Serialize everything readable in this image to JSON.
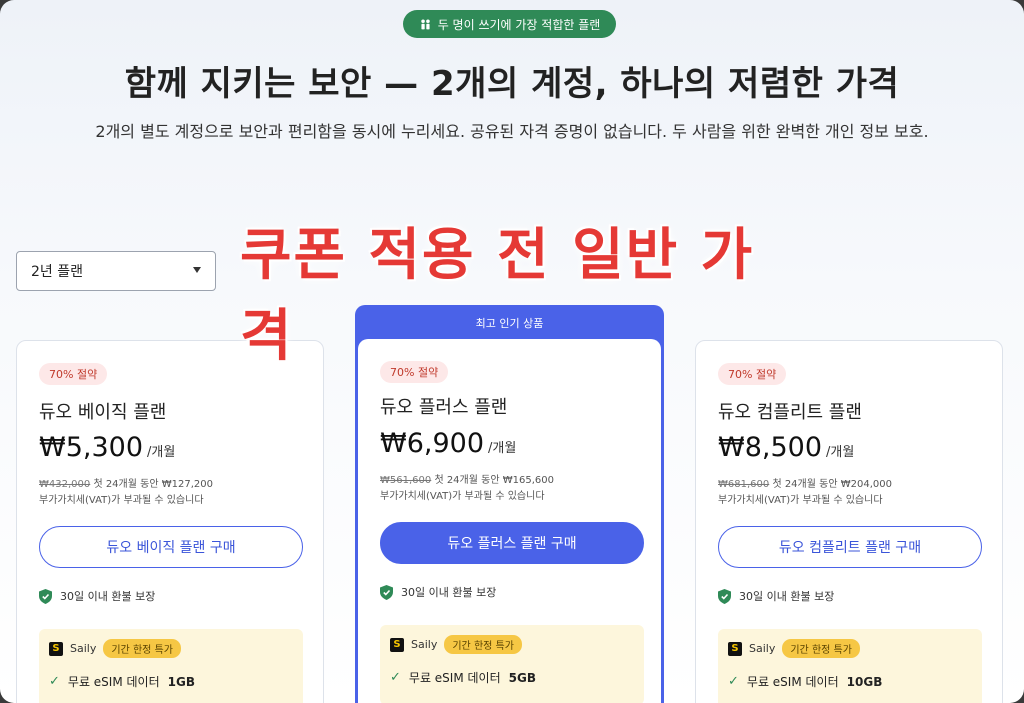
{
  "header": {
    "badge": "두 명이 쓰기에 가장 적합한 플랜",
    "title": "함께 지키는 보안 — 2개의 계정, 하나의 저렴한 가격",
    "subtitle": "2개의 별도 계정으로 보안과 편리함을 동시에 누리세요. 공유된 자격 증명이 없습니다. 두 사람을 위한 완벽한 개인 정보 보호."
  },
  "overlay_text": "쿠폰 적용 전 일반 가격",
  "plan_select": {
    "value": "2년 플랜"
  },
  "featured_label": "최고 인기 상품",
  "common": {
    "per_month": "/개월",
    "vat": "부가가치세(VAT)가 부과될 수 있습니다",
    "guarantee": "30일 이내 환불 보장",
    "promo_brand": "Saily",
    "promo_tag": "기간 한정 특가",
    "promo_prefix": "무료 eSIM 데이터",
    "first_period": "첫 24개월 동안"
  },
  "plans": [
    {
      "discount": "70% 절약",
      "name": "듀오 베이직 플랜",
      "price": "₩5,300",
      "old_price": "₩432,000",
      "new_total": "₩127,200",
      "button": "듀오 베이직 플랜 구매",
      "esim": "1GB"
    },
    {
      "discount": "70% 절약",
      "name": "듀오 플러스 플랜",
      "price": "₩6,900",
      "old_price": "₩561,600",
      "new_total": "₩165,600",
      "button": "듀오 플러스 플랜 구매",
      "esim": "5GB"
    },
    {
      "discount": "70% 절약",
      "name": "듀오 컴플리트 플랜",
      "price": "₩8,500",
      "old_price": "₩681,600",
      "new_total": "₩204,000",
      "button": "듀오 컴플리트 플랜 구매",
      "esim": "10GB"
    }
  ],
  "colors": {
    "accent": "#4a62e8",
    "badge_green": "#2f8a57",
    "overlay_red": "#e53935",
    "promo_bg": "#fdf6dc"
  }
}
